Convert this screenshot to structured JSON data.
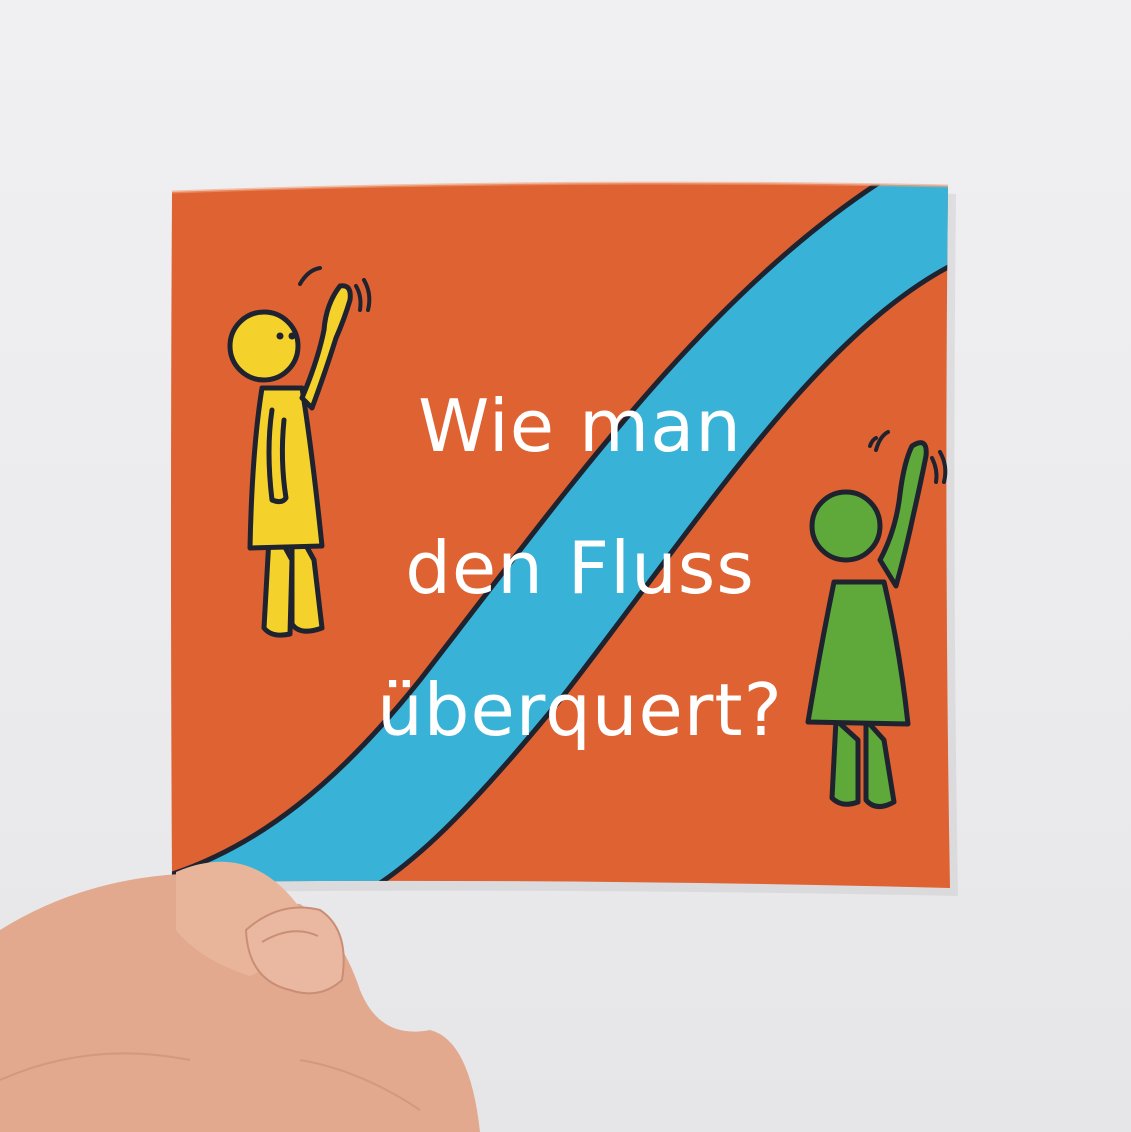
{
  "booklet": {
    "title_lines": [
      "Wie man",
      "den Fluss",
      "überquert?"
    ]
  },
  "colors": {
    "wall": "#ebebed",
    "cover_orange": "#df6232",
    "river_blue": "#38b3d7",
    "outline": "#1f2330",
    "figure_yellow": "#f4d22b",
    "figure_green": "#5fa83a",
    "title_text": "#ffffff",
    "skin": "#e2a98e"
  },
  "figures": [
    {
      "name": "yellow-figure",
      "gesture": "waving"
    },
    {
      "name": "green-figure",
      "gesture": "waving"
    }
  ]
}
